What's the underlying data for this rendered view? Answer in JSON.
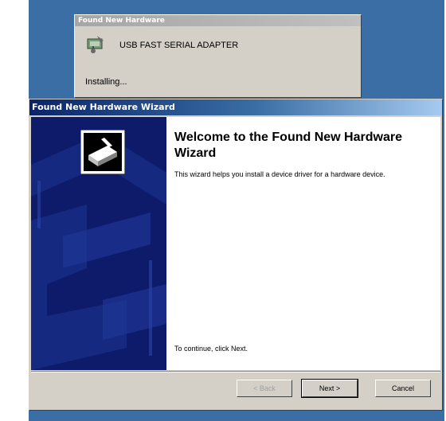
{
  "balloon": {
    "title": "Found New Hardware",
    "device_name": "USB FAST SERIAL ADAPTER",
    "status": "Installing...",
    "icon": "hardware-wizard-icon"
  },
  "wizard": {
    "title": "Found New Hardware Wizard",
    "heading": "Welcome to the Found New Hardware Wizard",
    "description": "This wizard helps you install a device driver for a hardware device.",
    "continue_text": "To continue, click Next.",
    "buttons": {
      "back": "< Back",
      "next": "Next >",
      "cancel": "Cancel"
    },
    "icon": "hardware-wizard-icon"
  },
  "colors": {
    "desktop": "#3a6ea5",
    "sidebar": "#0e1b6b",
    "titlebar": "#0a246a"
  }
}
